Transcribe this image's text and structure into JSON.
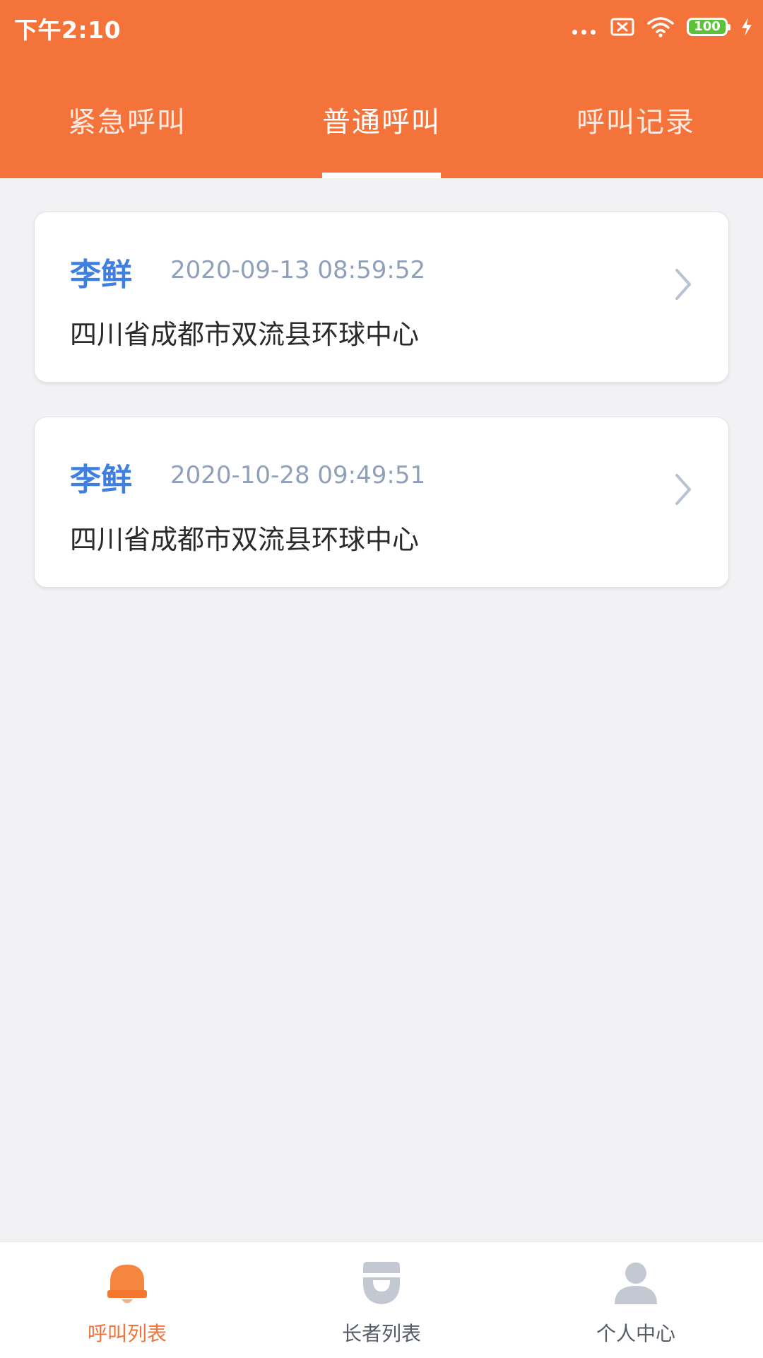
{
  "status_bar": {
    "time": "下午2:10",
    "battery": "100"
  },
  "tabs": [
    {
      "label": "紧急呼叫"
    },
    {
      "label": "普通呼叫"
    },
    {
      "label": "呼叫记录"
    }
  ],
  "calls": [
    {
      "name": "李鲜",
      "time": "2020-09-13 08:59:52",
      "address": "四川省成都市双流县环球中心"
    },
    {
      "name": "李鲜",
      "time": "2020-10-28 09:49:51",
      "address": "四川省成都市双流县环球中心"
    }
  ],
  "bottom_nav": [
    {
      "label": "呼叫列表",
      "icon": "bell-icon"
    },
    {
      "label": "长者列表",
      "icon": "elder-icon"
    },
    {
      "label": "个人中心",
      "icon": "person-icon"
    }
  ],
  "colors": {
    "accent": "#f4733a",
    "name_blue": "#3f7fe0",
    "battery_green": "#5cc23a"
  }
}
